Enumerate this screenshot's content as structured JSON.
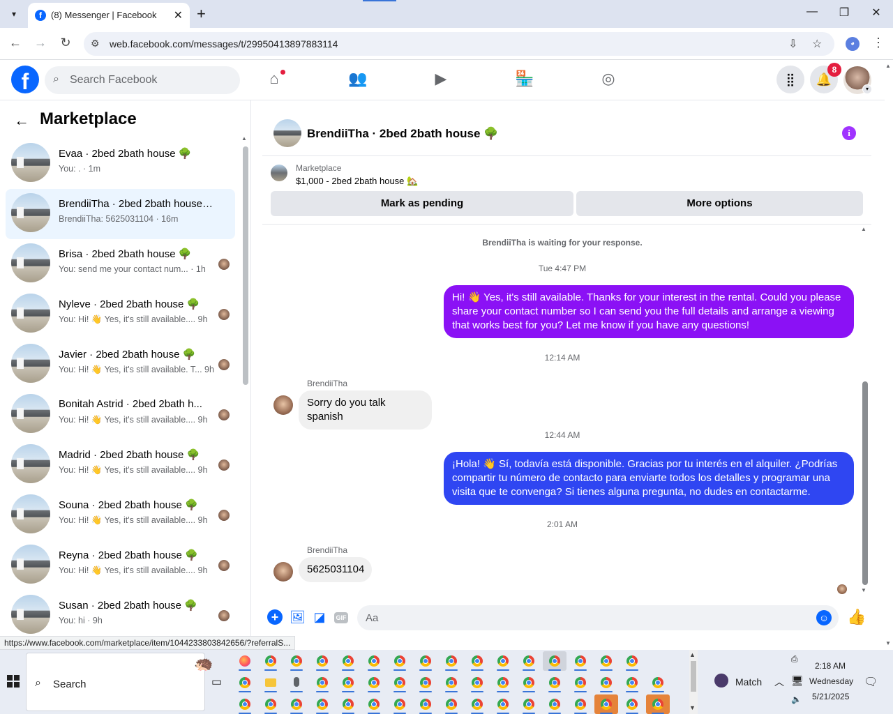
{
  "browser": {
    "tab_title": "(8) Messenger | Facebook",
    "url": "web.facebook.com/messages/t/29950413897883114",
    "status_url": "https://www.facebook.com/marketplace/item/1044233803842656/?referralS..."
  },
  "fb_header": {
    "search_placeholder": "Search Facebook",
    "notification_count": "8"
  },
  "left_panel": {
    "title": "Marketplace",
    "conversations": [
      {
        "name": "Evaa · 2bed 2bath house 🌳",
        "preview": "You: . · 1m",
        "active": false
      },
      {
        "name": "BrendiiTha · 2bed 2bath house 🌳",
        "preview": "BrendiiTha: 5625031104 · 16m",
        "active": true
      },
      {
        "name": "Brisa · 2bed 2bath house 🌳",
        "preview": "You: send me your contact num... · 1h",
        "active": false
      },
      {
        "name": "Nyleve · 2bed 2bath house 🌳",
        "preview": "You: Hi! 👋 Yes, it's still available.... 9h",
        "active": false
      },
      {
        "name": "Javier · 2bed 2bath house 🌳",
        "preview": "You: Hi! 👋 Yes, it's still available. T... 9h",
        "active": false
      },
      {
        "name": "Bonitah Astrid · 2bed 2bath h...",
        "preview": "You: Hi! 👋 Yes, it's still available.... 9h",
        "active": false
      },
      {
        "name": "Madrid · 2bed 2bath house 🌳",
        "preview": "You: Hi! 👋 Yes, it's still available.... 9h",
        "active": false
      },
      {
        "name": "Souna · 2bed 2bath house 🌳",
        "preview": "You: Hi! 👋 Yes, it's still available.... 9h",
        "active": false
      },
      {
        "name": "Reyna · 2bed 2bath house 🌳",
        "preview": "You: Hi! 👋 Yes, it's still available.... 9h",
        "active": false
      },
      {
        "name": "Susan · 2bed 2bath house 🌳",
        "preview": "You: hi · 9h",
        "active": false
      }
    ]
  },
  "chat": {
    "header_name": "BrendiiTha · 2bed 2bath house 🌳",
    "marketplace_label": "Marketplace",
    "listing_title": "$1,000 - 2bed 2bath house 🏡",
    "mark_pending_label": "Mark as pending",
    "more_options_label": "More options",
    "waiting_notice": "BrendiiTha is waiting for your response.",
    "timestamps": [
      "Tue 4:47 PM",
      "12:14 AM",
      "12:44 AM",
      "2:01 AM"
    ],
    "messages": [
      {
        "from": "me",
        "text": "Hi! 👋 Yes, it's still available. Thanks for your interest in the rental. Could you please share your contact number so I can send you the full details and arrange a viewing that works best for you? Let me know if you have any questions!",
        "color": "#8b11f5"
      },
      {
        "from": "BrendiiTha",
        "text": "Sorry do you talk spanish"
      },
      {
        "from": "me",
        "text": "¡Hola! 👋 Sí, todavía está disponible. Gracias por tu interés en el alquiler. ¿Podrías compartir tu número de contacto para enviarte todos los detalles y programar una visita que te convenga? Si tienes alguna pregunta, no dudes en contactarme.",
        "color": "#2f46f2"
      },
      {
        "from": "BrendiiTha",
        "text": "5625031104"
      }
    ],
    "composer_placeholder": "Aa",
    "gif_label": "GIF"
  },
  "taskbar": {
    "search_label": "Search",
    "weather_label": "Match",
    "time": "2:18 AM",
    "day": "Wednesday",
    "date": "5/21/2025"
  }
}
